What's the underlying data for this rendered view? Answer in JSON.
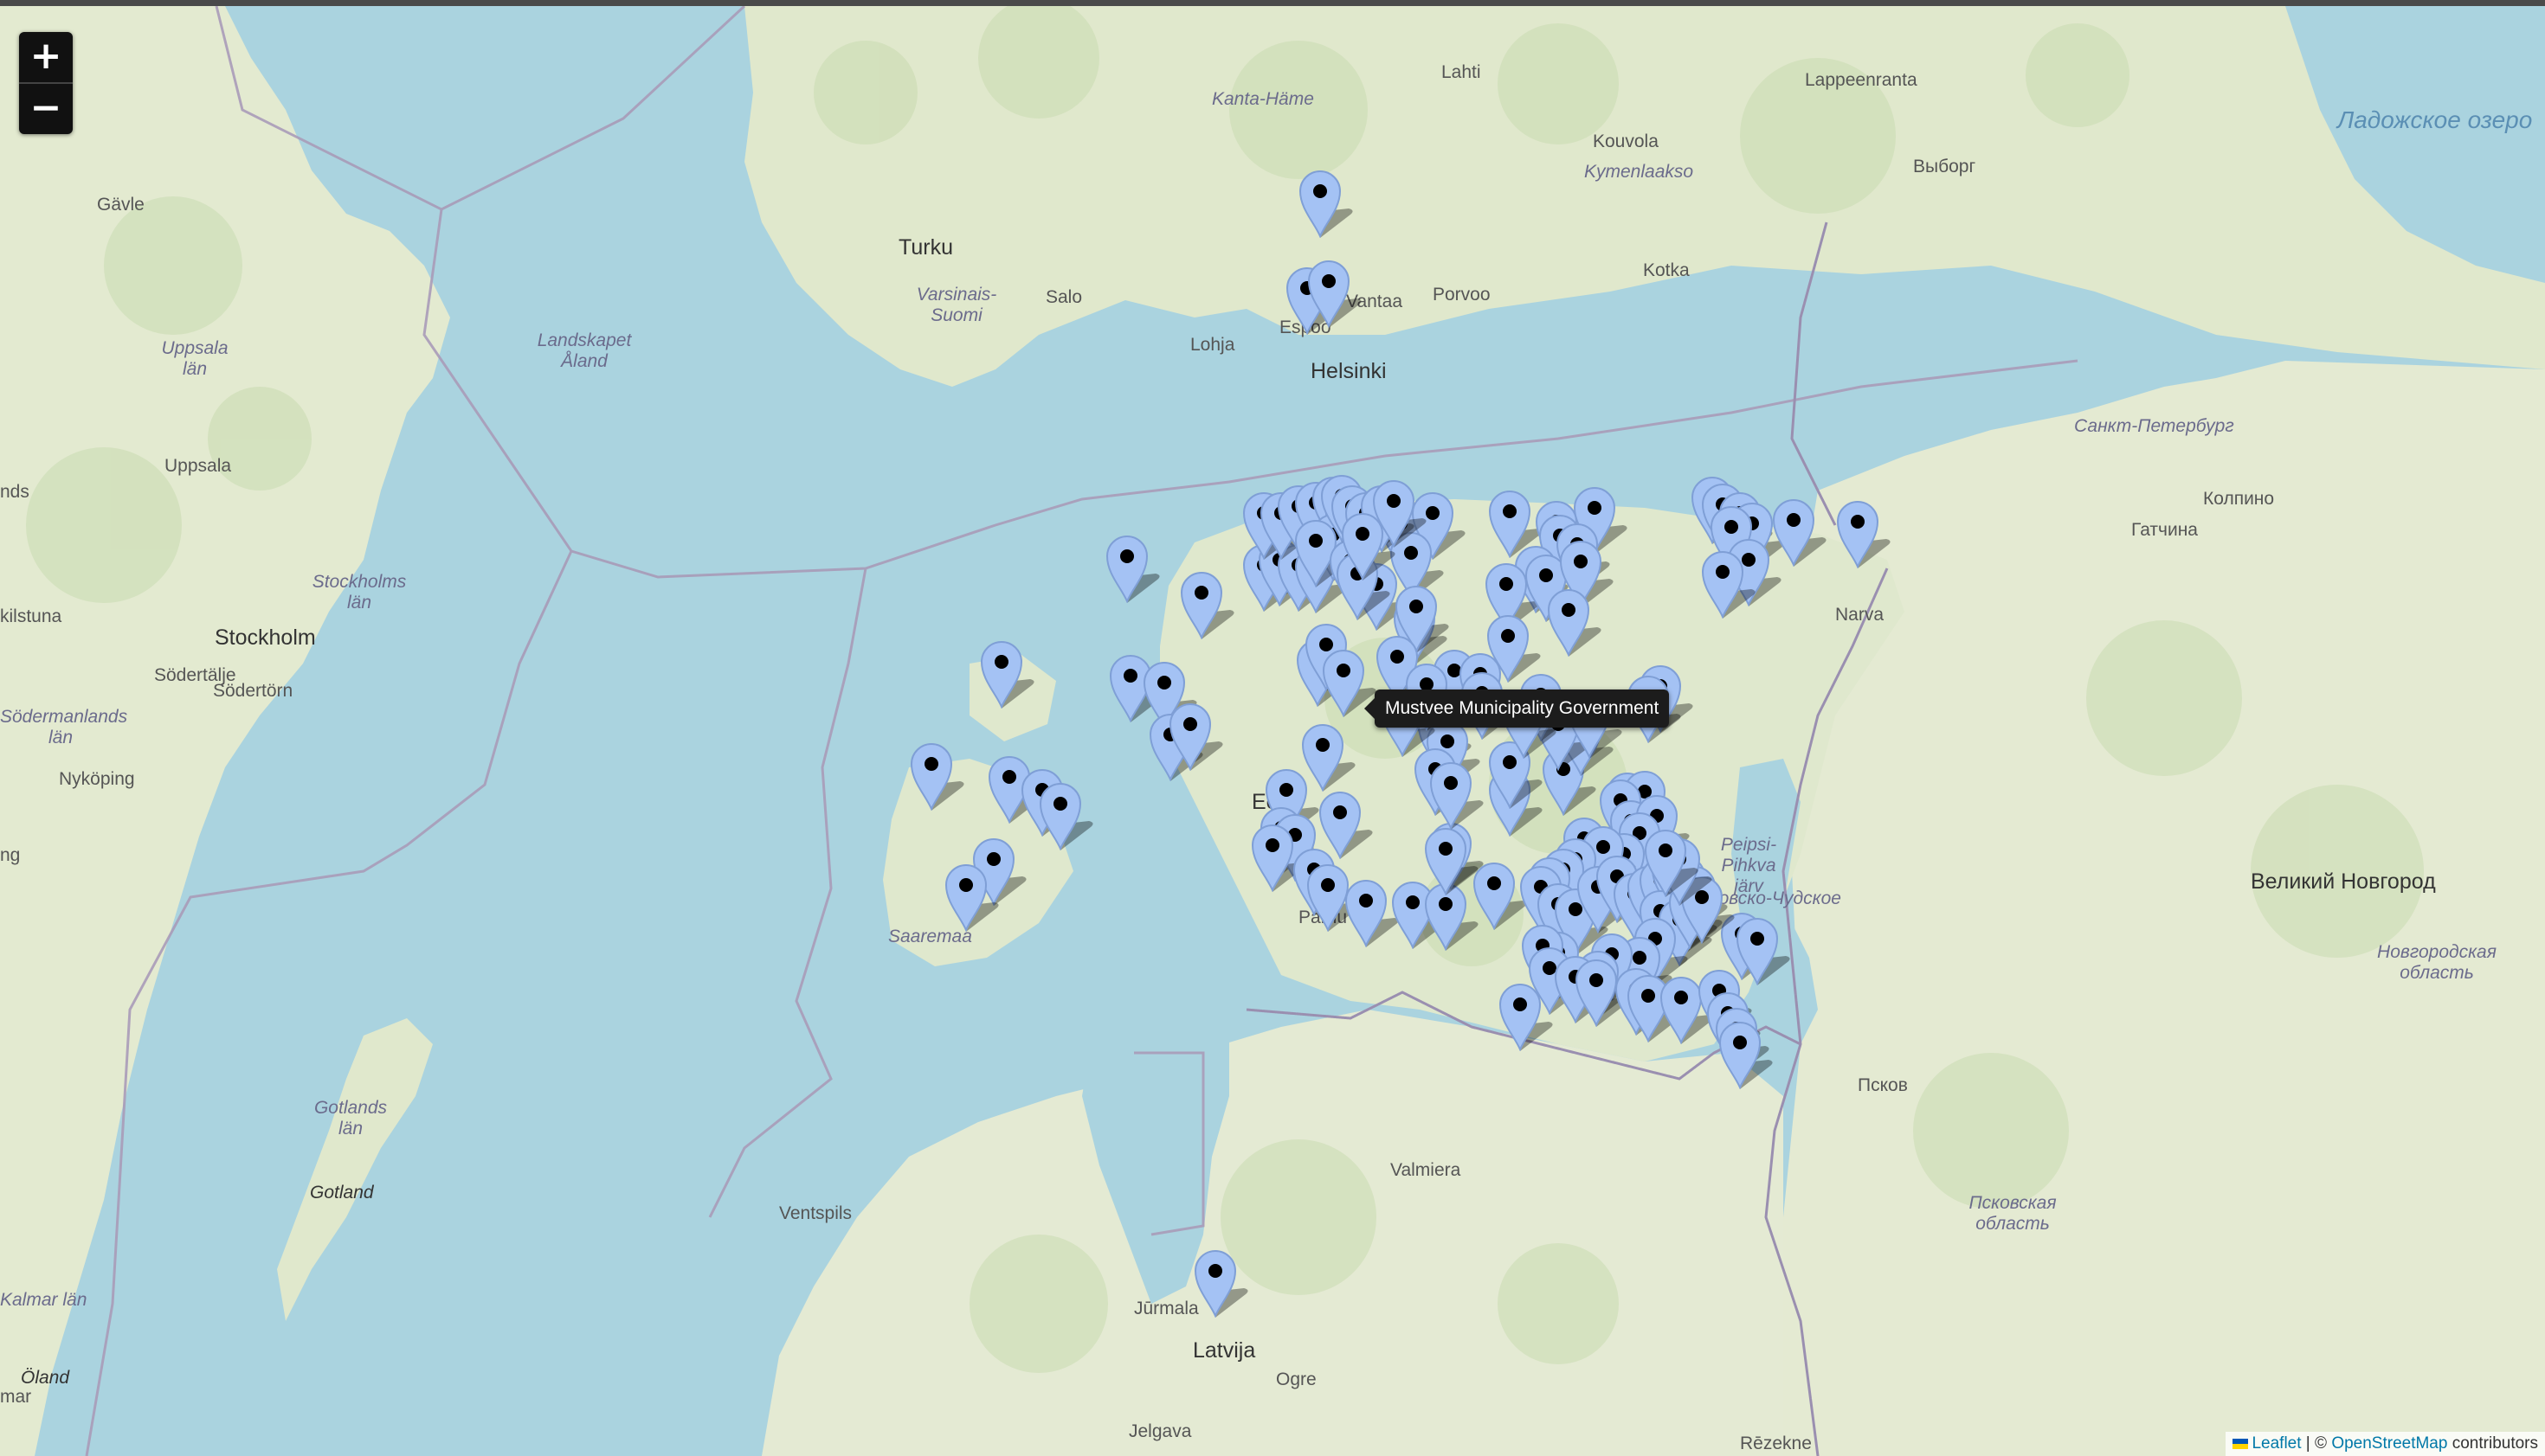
{
  "map": {
    "zoom_in_label": "+",
    "zoom_out_label": "−",
    "tooltip": "Mustvee Municipality Government",
    "attribution": {
      "leaflet": "Leaflet",
      "separator": " | © ",
      "osm": "OpenStreetMap",
      "contributors": " contributors"
    },
    "place_labels": [
      "Lahti",
      "Kanta-Häme",
      "Lappeenranta",
      "Kouvola",
      "Kymenlaakso",
      "Выборг",
      "Gävle",
      "Turku",
      "Salo",
      "Varsinais-Suomi",
      "Lohja",
      "Espoo",
      "Vantaa",
      "Porvoo",
      "Kotka",
      "Helsinki",
      "Landskapet Åland",
      "Uppsala län",
      "Uppsala",
      "Stockholms län",
      "Stockholm",
      "Södertälje",
      "Södertörn",
      "Södermanlands län",
      "Nyköping",
      "kilstuna",
      "nds",
      "Санкт-Петербург",
      "Колпино",
      "Гатчина",
      "Narva",
      "Ладожское озеро",
      "Eesti",
      "Saaremaa",
      "Pärnu",
      "Peipsi-Pihkva järv",
      "Псковско-Чудское",
      "Великий Новгород",
      "Новгородская область",
      "Псков",
      "Псковская область",
      "Valmiera",
      "Ventspils",
      "Gotlands län",
      "Gotland",
      "Kalmar län",
      "Öland",
      "Jūrmala",
      "Latvija",
      "Ogre",
      "Jelgava",
      "Rēzekne",
      "mar",
      "ng"
    ],
    "markers_count": 150
  }
}
